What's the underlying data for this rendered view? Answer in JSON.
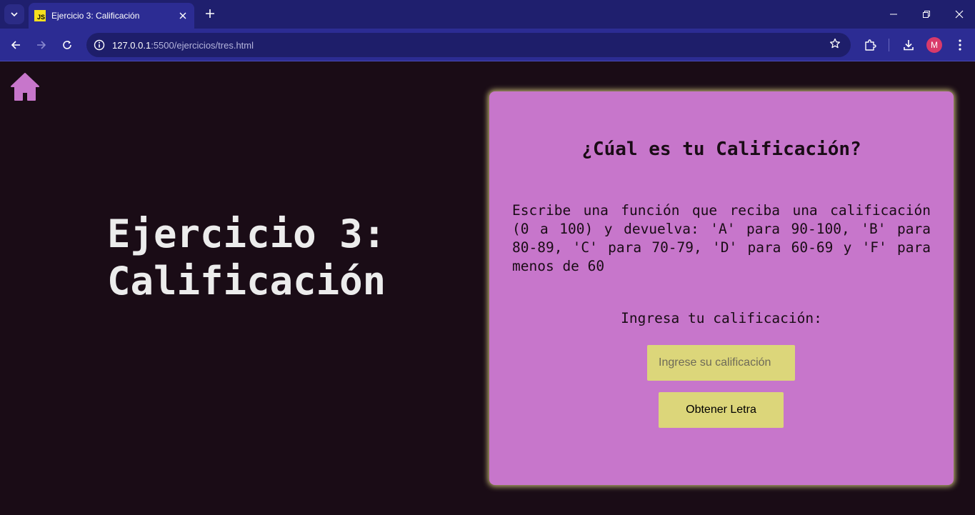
{
  "browser": {
    "tab_title": "Ejercicio 3: Calificación",
    "favicon_text": "JS",
    "url_host": "127.0.0.1",
    "url_path": ":5500/ejercicios/tres.html",
    "profile_initial": "M"
  },
  "page": {
    "hero_title_line1": "Ejercicio 3:",
    "hero_title_line2": "Calificación",
    "card": {
      "title": "¿Cúal es tu Calificación?",
      "description": "Escribe una función que reciba una calificación (0 a 100) y devuelva: 'A' para 90-100, 'B' para 80-89, 'C' para 70-79, 'D' para 60-69 y 'F' para menos de 60",
      "input_label": "Ingresa tu calificación:",
      "input_placeholder": "Ingrese su calificación",
      "input_value": "",
      "button_label": "Obtener Letra"
    }
  },
  "colors": {
    "page_background": "#1a0c16",
    "card_background": "#c776cb",
    "accent_yellow": "#dcd67a",
    "home_icon": "#c776cb"
  },
  "icons": [
    "home-icon",
    "chevron-down-icon",
    "close-icon",
    "plus-icon",
    "back-arrow-icon",
    "forward-arrow-icon",
    "reload-icon",
    "site-info-icon",
    "star-icon",
    "extensions-icon",
    "download-icon",
    "kebab-menu-icon"
  ]
}
